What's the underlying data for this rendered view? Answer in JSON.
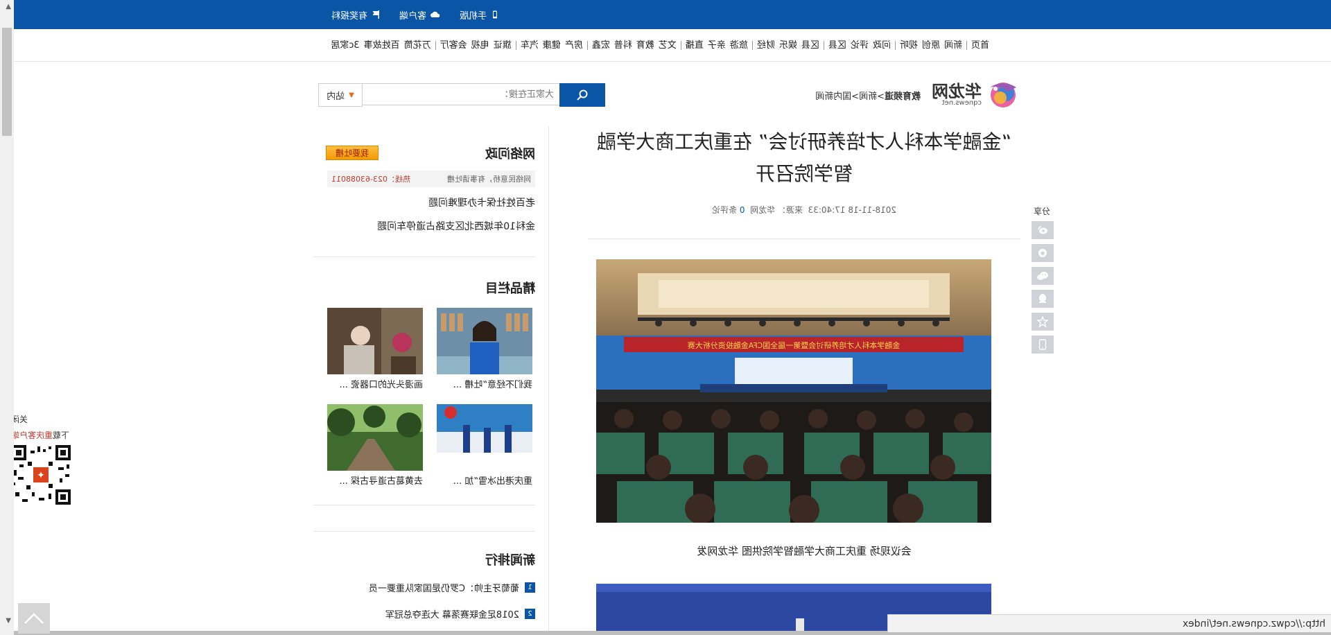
{
  "topbar": {
    "links": [
      {
        "label": "手机版",
        "icon": "phone-icon"
      },
      {
        "label": "客户端",
        "icon": "cloud-icon"
      },
      {
        "label": "有奖报料",
        "icon": "flag-icon"
      }
    ]
  },
  "nav": {
    "groups": [
      [
        "首页"
      ],
      [
        "新闻",
        "原创",
        "视听"
      ],
      [
        "问政",
        "评论",
        "区县"
      ],
      [
        "区县",
        "娱乐",
        "财经"
      ],
      [
        "旅游",
        "亲子",
        "直播"
      ],
      [
        "文艺",
        "教育",
        "科普",
        "宏鑫"
      ],
      [
        "房产",
        "健康",
        "汽车"
      ],
      [
        "旗证",
        "电视",
        "会客厅"
      ],
      [
        "万花筒",
        "百姓故事",
        "3c家居"
      ]
    ]
  },
  "logo": {
    "name": "华龙网",
    "domain": "cqnews.net"
  },
  "breadcrumb": {
    "items": [
      "教育频道",
      "新闻",
      "国内新闻"
    ],
    "separator": ">"
  },
  "search": {
    "scope": "站内",
    "placeholder": "大家正在搜："
  },
  "share": {
    "title": "分享",
    "buttons": [
      "weibo-icon",
      "qzone-icon",
      "wechat-icon",
      "qq-icon",
      "favorite-star-icon",
      "mobile-icon"
    ]
  },
  "article": {
    "headline": "“金融学本科人才培养研讨会” 在重庆工商大学融智学院召开",
    "meta": {
      "datetime": "2018-11-18 17:40:33",
      "source_label": "来源：",
      "source": "华龙网",
      "comments_count": "0",
      "comments_label": "条评论"
    },
    "caption": "会议现场 重庆工商大学融智学院供图 华龙网发",
    "photo_banner_text": "金融学本科人才培养研讨会暨第一届全国CFA金融投资分析大赛"
  },
  "sidebar": {
    "wenzheng": {
      "title": "网络问政",
      "button": "我要吐槽",
      "hotline_left": "网络民意桥，有事请吐槽",
      "hotline_label": "热线：",
      "hotline_number": "023-63088011",
      "links": [
        "老百姓社保卡办理难问题",
        "金科10年城西北区支路占道停车问题"
      ]
    },
    "jingpin": {
      "title": "精品栏目",
      "items": [
        {
          "caption": "我们不经意“吐槽 ..."
        },
        {
          "caption": "画漫头光的口器瓷 ..."
        },
        {
          "caption": "重庆港出冰雪“加 ..."
        },
        {
          "caption": "去黄葛古道寻古探 ..."
        }
      ]
    },
    "ranking": {
      "title": "新闻排行",
      "items": [
        {
          "num": "1",
          "text": "葡萄牙主帅：C罗仍是国家队重要一员"
        },
        {
          "num": "2",
          "text": "2018足金联赛落幕 大连夺总冠军"
        }
      ]
    }
  },
  "qr": {
    "close": "关闭",
    "label_pre": "下载",
    "label_red": "重庆客户端"
  },
  "browser": {
    "status_url": "http://cqwz.cqnews.net/index"
  },
  "colors": {
    "brand_blue": "#0a55a6",
    "accent_orange": "#f39a00",
    "hotline_red": "#c0392b"
  }
}
